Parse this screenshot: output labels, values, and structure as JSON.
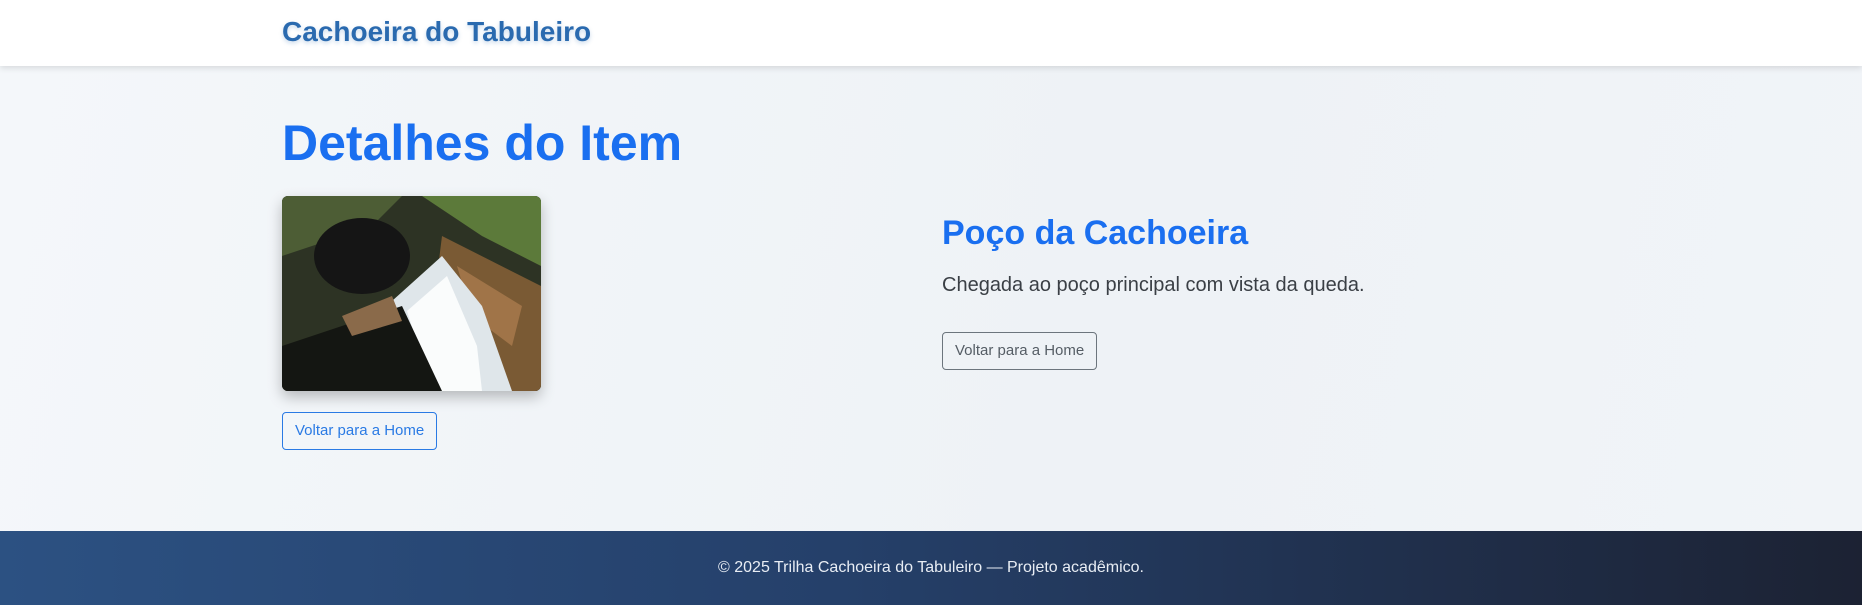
{
  "navbar": {
    "brand": "Cachoeira do Tabuleiro"
  },
  "main": {
    "title": "Detalhes do Item",
    "image": {
      "alt": "Poço da Cachoeira"
    },
    "primary_button": "Voltar para a Home",
    "item": {
      "title": "Poço da Cachoeira",
      "description": "Chegada ao poço principal com vista da queda.",
      "back_button": "Voltar para a Home"
    }
  },
  "footer": {
    "text": "© 2025 Trilha Cachoeira do Tabuleiro — Projeto acadêmico."
  },
  "colors": {
    "accent": "#1a6ff0",
    "brand": "#2a6aaf",
    "footer_start": "#2c5182",
    "footer_end": "#1c2233"
  }
}
